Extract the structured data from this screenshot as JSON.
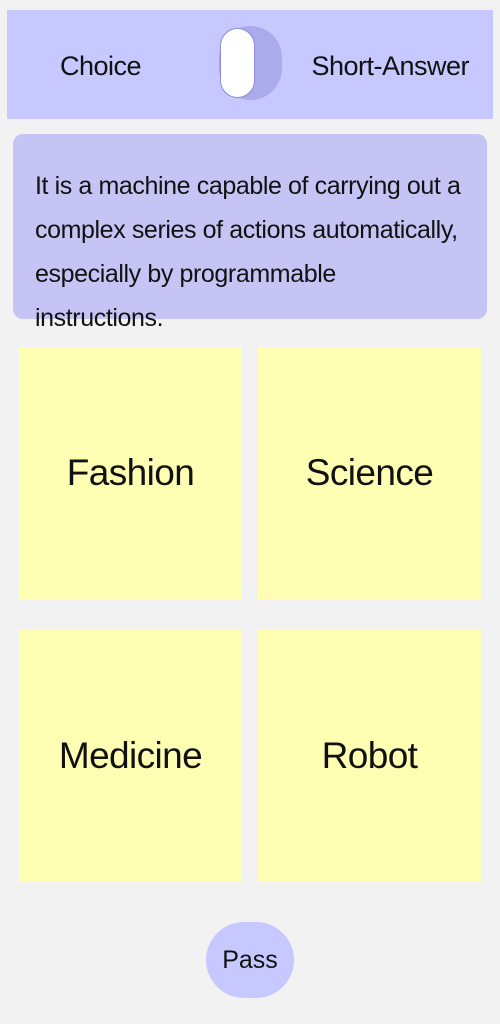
{
  "mode_bar": {
    "left_label": "Choice",
    "right_label": "Short-Answer",
    "toggle_state": "Choice"
  },
  "question": {
    "text": "It is a machine capable of carrying out a complex series of actions automatically, especially by programmable instructions."
  },
  "answers": [
    {
      "label": "Fashion"
    },
    {
      "label": "Science"
    },
    {
      "label": "Medicine"
    },
    {
      "label": "Robot"
    }
  ],
  "pass_button": {
    "label": "Pass"
  },
  "colors": {
    "background": "#f2f2f2",
    "mode_bar": "#c6c8ff",
    "question_card": "#c6c4f5",
    "answer_tile": "#ffffb3",
    "pass_button": "#c6c8ff"
  }
}
